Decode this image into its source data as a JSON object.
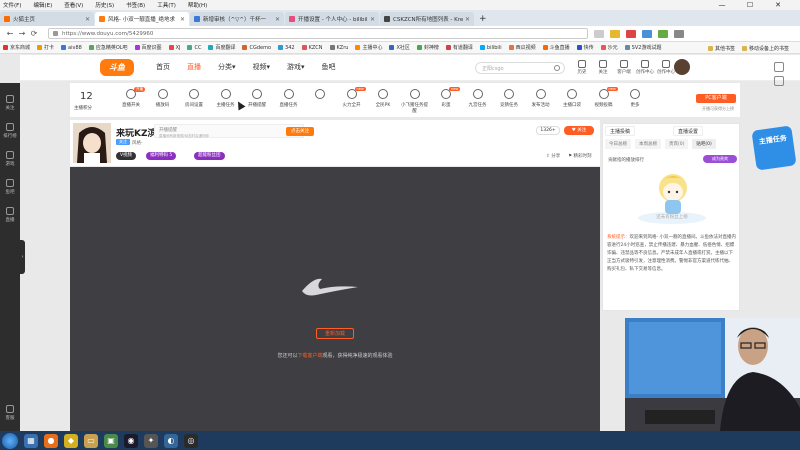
{
  "menu": [
    "文件(F)",
    "编辑(E)",
    "查看(V)",
    "历史(S)",
    "书签(B)",
    "工具(T)",
    "帮助(H)"
  ],
  "window_controls": [
    "—",
    "☐",
    "✕"
  ],
  "tabs": [
    {
      "title": "火狐主页",
      "active": false,
      "color": "#ff6a00"
    },
    {
      "title": "风格- 小双一靓直播_绝地求",
      "active": true,
      "color": "#ff7b0d"
    },
    {
      "title": "新增审核（^▽^）千杯一",
      "active": false,
      "color": "#3a79d8"
    },
    {
      "title": "开播设置 - 个人中心 - bilibili",
      "active": false,
      "color": "#e64c7c"
    },
    {
      "title": "CSKZCN所有地图列表 - Kreedz",
      "active": false,
      "color": "#444"
    }
  ],
  "new_tab_label": "+",
  "address": {
    "url": "https://www.douyu.com/5429960",
    "back": "←",
    "forward": "→",
    "reload": "⟳"
  },
  "bookmarks": [
    "京东商城",
    "打卡",
    "aiv88",
    "应急精英OL吧",
    "百度识图",
    "XJ",
    "CC",
    "百度翻译",
    "CGdemo",
    "342",
    "KZCN",
    "KZru",
    "主播中心",
    "X社区",
    "封神榜",
    "有道翻译",
    "bilibili",
    "西瓜视频",
    "斗鱼直播",
    "快传",
    "沙元",
    "SV2游戏试题"
  ],
  "bookmarks_right": [
    "其他书签",
    "移动设备上的书签"
  ],
  "site": {
    "logo": "斗鱼",
    "nav": [
      {
        "label": "首页",
        "on": false
      },
      {
        "label": "直播",
        "on": true
      },
      {
        "label": "分类▾",
        "on": false
      },
      {
        "label": "视频▾",
        "on": false
      },
      {
        "label": "游戏▾",
        "on": false
      },
      {
        "label": "鱼吧",
        "on": false
      }
    ],
    "search_placeholder": "正阳csgo",
    "header_icons": [
      "历史",
      "关注",
      "客户端",
      "创作中心",
      "创作中心"
    ]
  },
  "leftbar": [
    "关注",
    "排行榜",
    "游戏",
    "鱼吧",
    "直播"
  ],
  "leftbar_bottom": "客服",
  "collapse": "›",
  "toolbar": {
    "level_num": "12",
    "level_label": "主播积分",
    "tools": [
      {
        "label": "直播开关",
        "badge": "开播"
      },
      {
        "label": "播放码",
        "badge": ""
      },
      {
        "label": "房间设置",
        "badge": ""
      },
      {
        "label": "主播任务",
        "badge": ""
      },
      {
        "label": "开播提醒",
        "badge": ""
      },
      {
        "label": "直播任务",
        "badge": ""
      },
      {
        "label": "",
        "badge": ""
      },
      {
        "label": "火力全开",
        "badge": "new"
      },
      {
        "label": "全民PK",
        "badge": ""
      },
      {
        "label": "小飞猪任务提醒",
        "badge": ""
      },
      {
        "label": "彩蛋",
        "badge": "new"
      },
      {
        "label": "九宫任务",
        "badge": ""
      },
      {
        "label": "竞猜任务",
        "badge": ""
      },
      {
        "label": "发布活动",
        "badge": ""
      },
      {
        "label": "主播口袋",
        "badge": ""
      },
      {
        "label": "视频投稿",
        "badge": "new"
      },
      {
        "label": "更多",
        "badge": ""
      }
    ],
    "pc_client": "PC客户端",
    "pc_client_sub": "开播可获得分上榜"
  },
  "anchor": {
    "title": "来玩KZ滨",
    "tag": "关注",
    "sub": "风格-",
    "follow_text": "开播提醒",
    "follow_sub": "直播间有新视频/动态时会通知你",
    "follow_btn": "点击关注",
    "v_btn": "V视频",
    "pills": [
      "福利特码 5",
      "超能粉丝团"
    ],
    "viewers": "1326+",
    "like_btn": "♥ 关注",
    "share": "⇪ 分享",
    "report": "⚑ 精彩时刻"
  },
  "player": {
    "reload_btn": "重新加载",
    "hint_pre": "您还可以",
    "hint_link": "下载客户端",
    "hint_post": "观看，获得纯净极速的观看体验"
  },
  "right_panel": {
    "btn_left": "主播投稿",
    "btn_right": "直播设置",
    "tabs": [
      {
        "label": "今日总榜",
        "on": false
      },
      {
        "label": "本周总榜",
        "on": false
      },
      {
        "label": "贵宾(0)",
        "on": false
      },
      {
        "label": "贴吧(0)",
        "on": true
      }
    ],
    "rank_label": "贡献指的播放排行",
    "rank_btn": "成为贵宾",
    "mascot_caption": "还未有粉丝上榜",
    "sys_prefix": "系统提示：",
    "sys_msg": "欢迎来到风格- 小双一靓的直播间。斗鱼依法对直播内容进行24小时巡查，禁止传播违建、暴力血腥、低俗色情、招嫖诈骗、违禁品等不良信息。严禁未成年人直播或打赏。主播以下正当方式吸特引发，注意理性消费。警惕非官方渠道代练代抽、购买礼包、私下交易等信息。"
  },
  "promo": "主播任务",
  "taskbar_icons": [
    {
      "color": "#3a70b0",
      "glyph": "▦"
    },
    {
      "color": "#e86e1a",
      "glyph": "●"
    },
    {
      "color": "#d4b020",
      "glyph": "◆"
    },
    {
      "color": "#c8a050",
      "glyph": "▭"
    },
    {
      "color": "#4a8a4a",
      "glyph": "▣"
    },
    {
      "color": "#1a1a2a",
      "glyph": "◉"
    },
    {
      "color": "#555",
      "glyph": "✦"
    },
    {
      "color": "#336699",
      "glyph": "◐"
    },
    {
      "color": "#2a2a2a",
      "glyph": "◎"
    }
  ]
}
